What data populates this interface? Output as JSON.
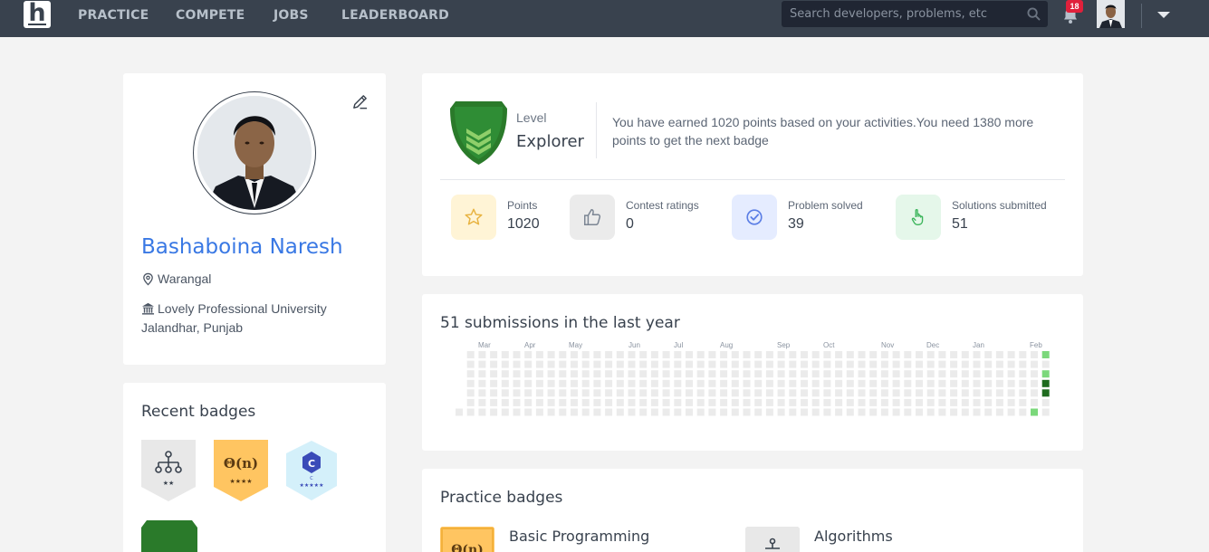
{
  "nav": {
    "logo_letter": "h",
    "links": [
      "PRACTICE",
      "COMPETE",
      "JOBS",
      "LEADERBOARD"
    ],
    "search_placeholder": "Search developers, problems, etc",
    "notification_count": "18"
  },
  "profile": {
    "name": "Bashaboina Naresh",
    "location": "Warangal",
    "institution": "Lovely Professional University Jalandhar, Punjab"
  },
  "recent_badges": {
    "title": "Recent badges",
    "items": [
      {
        "icon": "hierarchy-icon",
        "stars": "★★",
        "color": "#e8e8e8"
      },
      {
        "icon": "big-o-icon",
        "label": "Θ(n)",
        "stars": "★★★★",
        "color": "#ffc561"
      },
      {
        "icon": "c-language-icon",
        "label": "C",
        "sub": "C",
        "stars": "★★★★★",
        "color": "#d4f0fa"
      }
    ]
  },
  "level": {
    "label": "Level",
    "name": "Explorer",
    "message": "You have earned 1020 points based on your activities.You need 1380 more points to get the next badge",
    "badge_color": "#2a7a2a"
  },
  "stats": [
    {
      "label": "Points",
      "value": "1020",
      "icon": "star-icon",
      "bg": "#fff4d6",
      "color": "#e8b341"
    },
    {
      "label": "Contest ratings",
      "value": "0",
      "icon": "thumbs-up-icon",
      "bg": "#ebebeb",
      "color": "#7b8593"
    },
    {
      "label": "Problem solved",
      "value": "39",
      "icon": "check-circle-icon",
      "bg": "#e5ecff",
      "color": "#5b7ee5"
    },
    {
      "label": "Solutions submitted",
      "value": "51",
      "icon": "pointer-hand-icon",
      "bg": "#e5f7ea",
      "color": "#3cb55b"
    }
  ],
  "submissions": {
    "title": "51 submissions in the last year",
    "months": [
      "Mar",
      "Apr",
      "May",
      "Jun",
      "Jul",
      "Aug",
      "Sep",
      "Oct",
      "Nov",
      "Dec",
      "Jan",
      "Feb"
    ],
    "active_cells": [
      {
        "week": 51,
        "day": 0,
        "level": 1
      },
      {
        "week": 51,
        "day": 2,
        "level": 1
      },
      {
        "week": 51,
        "day": 3,
        "level": 3
      },
      {
        "week": 51,
        "day": 4,
        "level": 3
      },
      {
        "week": 50,
        "day": 6,
        "level": 1
      }
    ],
    "colors": {
      "empty": "#ebebeb",
      "level1": "#7bd87b",
      "level3": "#1e6b1e"
    }
  },
  "practice_badges": {
    "title": "Practice badges",
    "items": [
      {
        "name": "Basic Programming",
        "icon": "big-o-icon",
        "label": "Θ(n)",
        "color": "#ffc561"
      },
      {
        "name": "Algorithms",
        "icon": "hierarchy-icon",
        "color": "#e8e8e8"
      }
    ]
  }
}
